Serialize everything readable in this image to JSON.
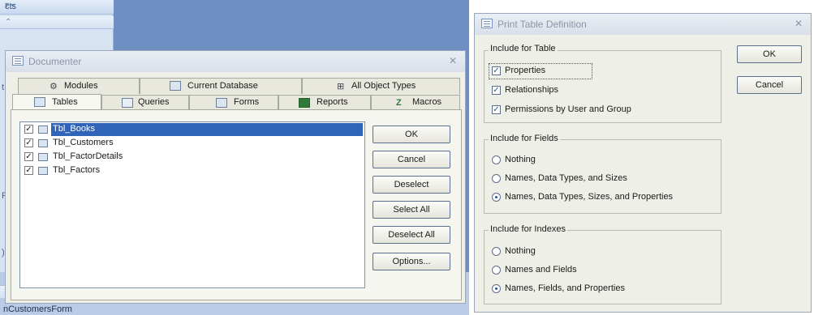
{
  "background": {
    "pane_top_label": "cts",
    "pane_footer_label": "nCustomersForm"
  },
  "documenter": {
    "title": "Documenter",
    "tabs_back": [
      {
        "label": "Modules",
        "icon": "modules-icon"
      },
      {
        "label": "Current Database",
        "icon": "database-icon"
      },
      {
        "label": "All Object Types",
        "icon": "all-object-types-icon"
      }
    ],
    "tabs_front": [
      {
        "label": "Tables",
        "icon": "table-icon",
        "active": true
      },
      {
        "label": "Queries",
        "icon": "query-icon"
      },
      {
        "label": "Forms",
        "icon": "form-icon"
      },
      {
        "label": "Reports",
        "icon": "report-icon"
      },
      {
        "label": "Macros",
        "icon": "macro-icon"
      }
    ],
    "tables": [
      {
        "name": "Tbl_Books",
        "checked": true,
        "selected": true
      },
      {
        "name": "Tbl_Customers",
        "checked": true,
        "selected": false
      },
      {
        "name": "Tbl_FactorDetails",
        "checked": true,
        "selected": false
      },
      {
        "name": "Tbl_Factors",
        "checked": true,
        "selected": false
      }
    ],
    "buttons": {
      "ok": "OK",
      "cancel": "Cancel",
      "deselect": "Deselect",
      "select_all": "Select All",
      "deselect_all": "Deselect All",
      "options": "Options..."
    }
  },
  "print_def": {
    "title": "Print Table Definition",
    "buttons": {
      "ok": "OK",
      "cancel": "Cancel"
    },
    "table_group": {
      "title": "Include for Table",
      "options": [
        {
          "label": "Properties",
          "checked": true
        },
        {
          "label": "Relationships",
          "checked": true
        },
        {
          "label": "Permissions by User and Group",
          "checked": true
        }
      ]
    },
    "fields_group": {
      "title": "Include for Fields",
      "options": [
        {
          "label": "Nothing",
          "selected": false
        },
        {
          "label": "Names, Data Types, and Sizes",
          "selected": false
        },
        {
          "label": "Names, Data Types, Sizes, and Properties",
          "selected": true
        }
      ]
    },
    "indexes_group": {
      "title": "Include for Indexes",
      "options": [
        {
          "label": "Nothing",
          "selected": false
        },
        {
          "label": "Names and Fields",
          "selected": false
        },
        {
          "label": "Names, Fields, and Properties",
          "selected": true
        }
      ]
    }
  }
}
